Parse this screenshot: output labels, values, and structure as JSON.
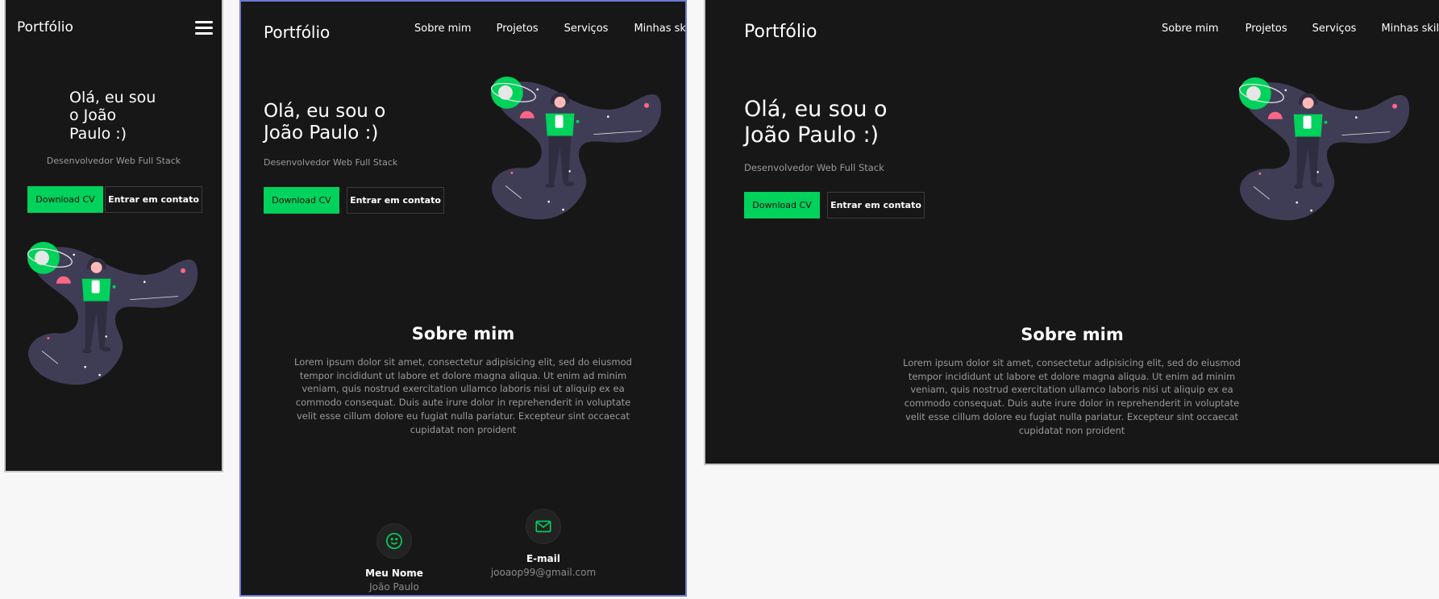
{
  "site": {
    "logo": "Portfólio",
    "nav": [
      "Sobre mim",
      "Projetos",
      "Serviços",
      "Minhas skills"
    ],
    "hero": {
      "title_line1": "Olá, eu sou o",
      "title_line2": "João Paulo :)",
      "mobile_line1": "Olá, eu sou",
      "mobile_line2": "o João",
      "mobile_line3": "Paulo :)",
      "subtitle": "Desenvolvedor Web Full Stack",
      "download_label": "Download CV",
      "contact_label": "Entrar em contato"
    },
    "about": {
      "title": "Sobre mim",
      "lines": [
        "Lorem ipsum dolor sit amet, consectetur adipisicing elit, sed do eiusmod",
        "tempor incididunt ut labore et dolore magna aliqua. Ut enim ad minim",
        "veniam, quis nostrud exercitation ullamco laboris nisi ut aliquip ex ea",
        "commodo consequat. Duis aute irure dolor in reprehenderit in voluptate",
        "velit esse cillum dolore eu fugiat nulla pariatur. Excepteur sint occaecat",
        "cupidatat non proident"
      ]
    },
    "contacts": [
      {
        "label": "Meu Nome",
        "value": "João Paulo",
        "icon": "smile-icon"
      },
      {
        "label": "E-mail",
        "value": "jooaop99@gmail.com",
        "icon": "mail-icon"
      }
    ],
    "colors": {
      "background": "#171717",
      "accent": "#00d25b",
      "muted": "#9a9a9a",
      "blob": "#3f3d56",
      "pink": "#ff6584"
    }
  }
}
